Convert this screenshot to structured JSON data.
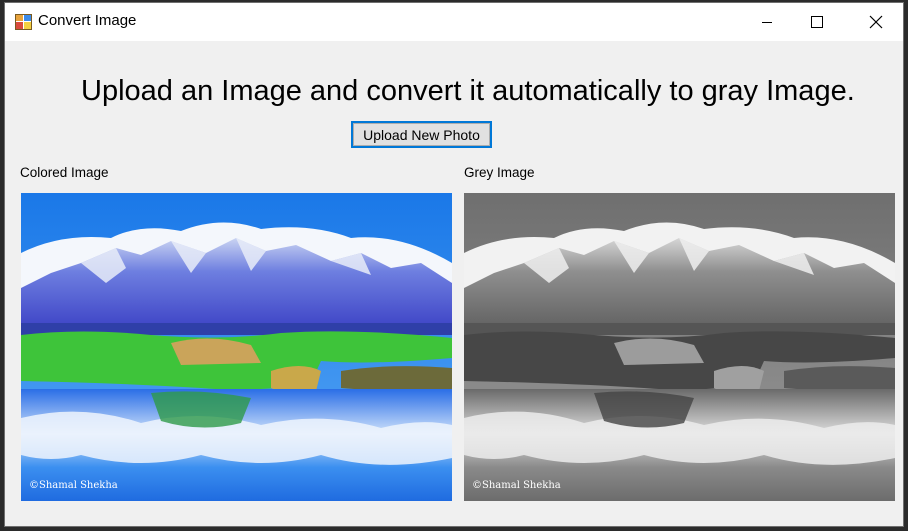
{
  "window": {
    "title": "Convert Image",
    "icon": "app-icon",
    "controls": [
      "minimize-icon",
      "maximize-icon",
      "close-icon"
    ]
  },
  "main": {
    "heading": "Upload an Image and convert it automatically to gray Image.",
    "upload_button_label": "Upload New Photo",
    "colored_label": "Colored Image",
    "grey_label": "Grey Image",
    "colored_watermark": "©Shamal Shekha",
    "grey_watermark": "©Shamal Shekha"
  },
  "colors": {
    "accent": "#0078d7",
    "window_bg": "#f0f0f0",
    "titlebar_bg": "#ffffff"
  }
}
